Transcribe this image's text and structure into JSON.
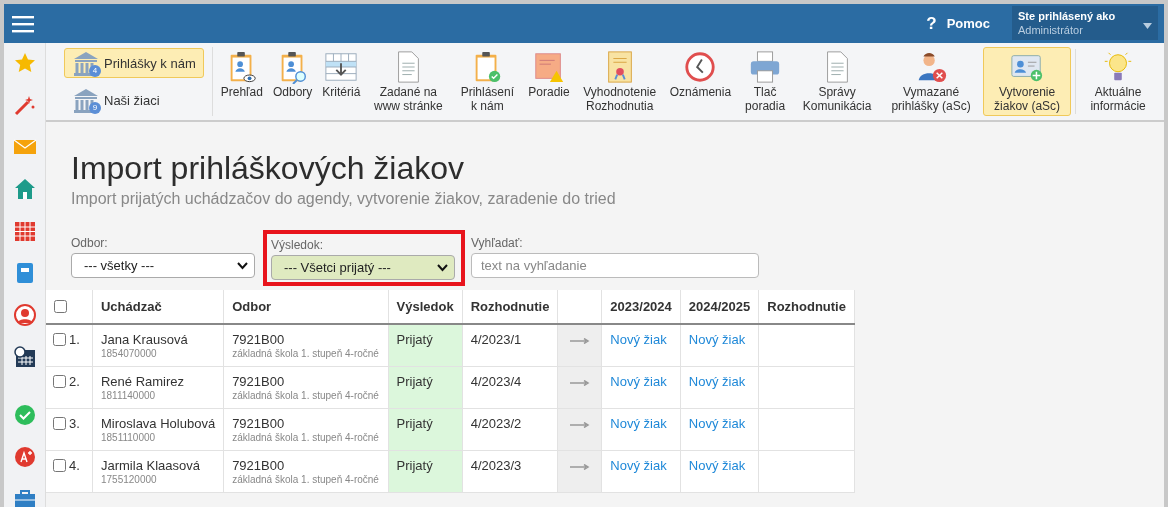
{
  "topbar": {
    "help_icon": "?",
    "help": "Pomoc",
    "user_label": "Ste prihlásený ako",
    "user_name": "Administrátor"
  },
  "toolbar": {
    "side_buttons": [
      {
        "label": "Prihlášky k nám",
        "badge": "4",
        "selected": true
      },
      {
        "label": "Naši žiaci",
        "badge": "9",
        "selected": false
      }
    ],
    "items": [
      {
        "label": "Prehľad",
        "selected": false
      },
      {
        "label": "Odbory",
        "selected": false
      },
      {
        "label": "Kritériá",
        "selected": false
      },
      {
        "label": "Zadané na www stránke",
        "selected": false
      },
      {
        "label": "Prihlásení k nám",
        "selected": false
      },
      {
        "label": "Poradie",
        "selected": false
      },
      {
        "label": "Vyhodnotenie Rozhodnutia",
        "selected": false
      },
      {
        "label": "Oznámenia",
        "selected": false
      },
      {
        "label": "Tlač poradia",
        "selected": false
      },
      {
        "label": "Správy Komunikácia",
        "selected": false
      },
      {
        "label": "Vymazané prihlášky (aSc)",
        "selected": false
      },
      {
        "label": "Vytvorenie žiakov (aSc)",
        "selected": true
      },
      {
        "label": "Aktuálne informácie",
        "selected": false
      }
    ]
  },
  "page": {
    "title": "Import prihláškových žiakov",
    "subtitle": "Import prijatých uchádzačov do agendy, vytvorenie žiakov, zaradenie do tried"
  },
  "filters": [
    {
      "kind": "select",
      "label": "Odbor:",
      "value": "--- všetky ---",
      "highlighted": false
    },
    {
      "kind": "select",
      "label": "Výsledok:",
      "value": "--- Všetci prijatý ---",
      "highlighted": true
    },
    {
      "kind": "search",
      "label": "Vyhľadať:",
      "placeholder": "text na vyhľadanie",
      "highlighted": false
    }
  ],
  "table": {
    "columns": [
      "Uchádzač",
      "Odbor",
      "Výsledok",
      "Rozhodnutie",
      "2023/2024",
      "2024/2025",
      "Rozhodnutie"
    ],
    "select_all_checked": false,
    "rows": [
      {
        "number": "1.",
        "checked": false,
        "name": "Jana Krausová",
        "id": "1854070000",
        "field_code": "7921B00",
        "field_name": "základná škola 1. stupeň 4-ročné",
        "result": "Prijatý",
        "decision": "4/2023/1",
        "year_1": "Nový žiak",
        "year_2": "Nový žiak"
      },
      {
        "number": "2.",
        "checked": false,
        "name": "René Ramirez",
        "id": "1811140000",
        "field_code": "7921B00",
        "field_name": "základná škola 1. stupeň 4-ročné",
        "result": "Prijatý",
        "decision": "4/2023/4",
        "year_1": "Nový žiak",
        "year_2": "Nový žiak"
      },
      {
        "number": "3.",
        "checked": false,
        "name": "Miroslava Holubová",
        "id": "1851110000",
        "field_code": "7921B00",
        "field_name": "základná škola 1. stupeň 4-ročné",
        "result": "Prijatý",
        "decision": "4/2023/2",
        "year_1": "Nový žiak",
        "year_2": "Nový žiak"
      },
      {
        "number": "4.",
        "checked": false,
        "name": "Jarmila Klaasová",
        "id": "1755120000",
        "field_code": "7921B00",
        "field_name": "základná škola 1. stupeň 4-ročné",
        "result": "Prijatý",
        "decision": "4/2023/3",
        "year_1": "Nový žiak",
        "year_2": "Nový žiak"
      }
    ]
  }
}
